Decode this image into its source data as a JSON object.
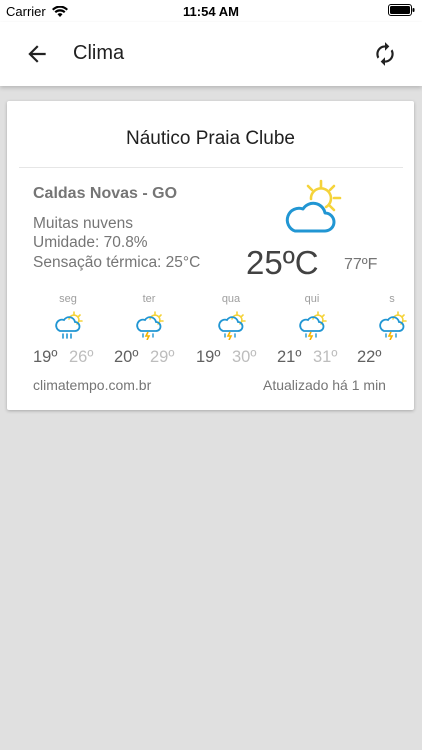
{
  "status_bar": {
    "carrier": "Carrier",
    "time": "11:54 AM"
  },
  "app_bar": {
    "title": "Clima"
  },
  "weather": {
    "location_name": "Náutico Praia Clube",
    "city": "Caldas Novas - GO",
    "condition": "Muitas nuvens",
    "humidity": "Umidade: 70.8%",
    "feels_like": "Sensação térmica: 25°C",
    "temp_c": "25ºC",
    "temp_f": "77ºF",
    "icon": "partly-cloudy-icon",
    "forecast": [
      {
        "day": "seg",
        "min": "19º",
        "max": "26º",
        "icon": "rain-sun-icon"
      },
      {
        "day": "ter",
        "min": "20º",
        "max": "29º",
        "icon": "storm-sun-icon"
      },
      {
        "day": "qua",
        "min": "19º",
        "max": "30º",
        "icon": "storm-sun-icon"
      },
      {
        "day": "qui",
        "min": "21º",
        "max": "31º",
        "icon": "storm-sun-icon"
      },
      {
        "day": "s",
        "min": "22º",
        "max": "",
        "icon": "storm-sun-icon"
      }
    ],
    "source": "climatempo.com.br",
    "updated": "Atualizado há 1 min"
  },
  "colors": {
    "sun": "#f5d33a",
    "cloud": "#2196d3",
    "bolt": "#f5b400"
  }
}
